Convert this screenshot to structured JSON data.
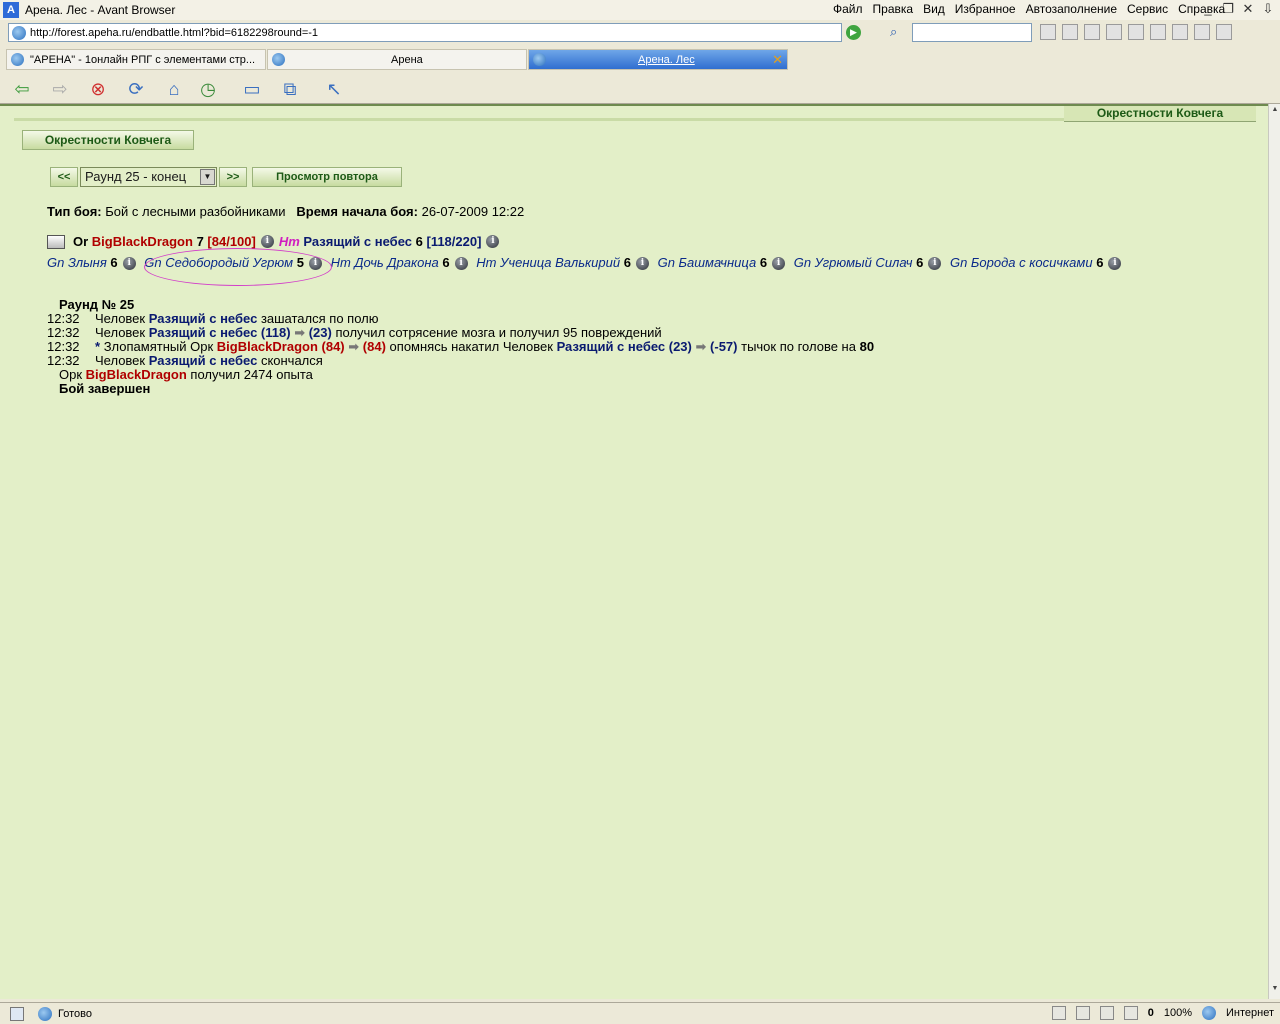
{
  "window": {
    "title": "Арена. Лес - Avant Browser",
    "menus": [
      "Файл",
      "Правка",
      "Вид",
      "Избранное",
      "Автозаполнение",
      "Сервис",
      "Справка"
    ]
  },
  "address": {
    "url": "http://forest.apeha.ru/endbattle.html?bid=6182298round=-1"
  },
  "tabs": [
    {
      "label": "\"АРЕНА\" - 1онлайн РПГ с элементами стр..."
    },
    {
      "label": "Арена"
    },
    {
      "label": "Арена. Лес"
    }
  ],
  "page": {
    "location_right": "Окрестности Ковчега",
    "location_left": "Окрестности Ковчега",
    "prev_label": "<<",
    "next_label": ">>",
    "round_selected": "Раунд 25 - конец",
    "replay_label": "Просмотр повтора",
    "battle_type_label": "Тип боя:",
    "battle_type_value": "Бой с лесными разбойниками",
    "start_time_label": "Время начала боя:",
    "start_time_value": "26-07-2009 12:22"
  },
  "side_a": {
    "race1": "Or",
    "name1": "BigBlackDragon",
    "level1": "7",
    "hp1": "[84/100]",
    "race2": "Hm",
    "name2": "Разящий с небес",
    "level2": "6",
    "hp2": "[118/220]"
  },
  "side_b": [
    {
      "name": "Gn Злыня",
      "level": "6"
    },
    {
      "name": "Gn Седобородый Угрюм",
      "level": "5"
    },
    {
      "name": "Hm Дочь Дракона",
      "level": "6"
    },
    {
      "name": "Hm Ученица Валькирий",
      "level": "6"
    },
    {
      "name": "Gn Башмачница",
      "level": "6"
    },
    {
      "name": "Gn Угрюмый Силач",
      "level": "6"
    },
    {
      "name": "Gn Борода с косичками",
      "level": "6"
    }
  ],
  "log": {
    "round_title": "Раунд № 25",
    "time": "12:32",
    "l1_a": "Человек",
    "l1_name": "Разящий с небес",
    "l1_b": "зашатался по полю",
    "l2_a": "Человек",
    "l2_name": "Разящий с небес (118)",
    "l2_val": "(23)",
    "l2_b": "получил сотрясение мозга и получил 95 повреждений",
    "l3_star": "*",
    "l3_a": "Злопамятный Орк",
    "l3_name": "BigBlackDragon (84)",
    "l3_val": "(84)",
    "l3_b": "опомнясь накатил Человек",
    "l3_target": "Разящий с небес (23)",
    "l3_val2": "(-57)",
    "l3_c": "тычок по голове на",
    "l3_dmg": "80",
    "l4_a": "Человек",
    "l4_name": "Разящий с небес",
    "l4_b": "скончался",
    "exp_a": "Орк",
    "exp_name": "BigBlackDragon",
    "exp_b": "получил 2474 опыта",
    "end": "Бой завершен"
  },
  "status": {
    "text": "Готово",
    "count": "0",
    "zoom": "100%",
    "zone": "Интернет"
  }
}
